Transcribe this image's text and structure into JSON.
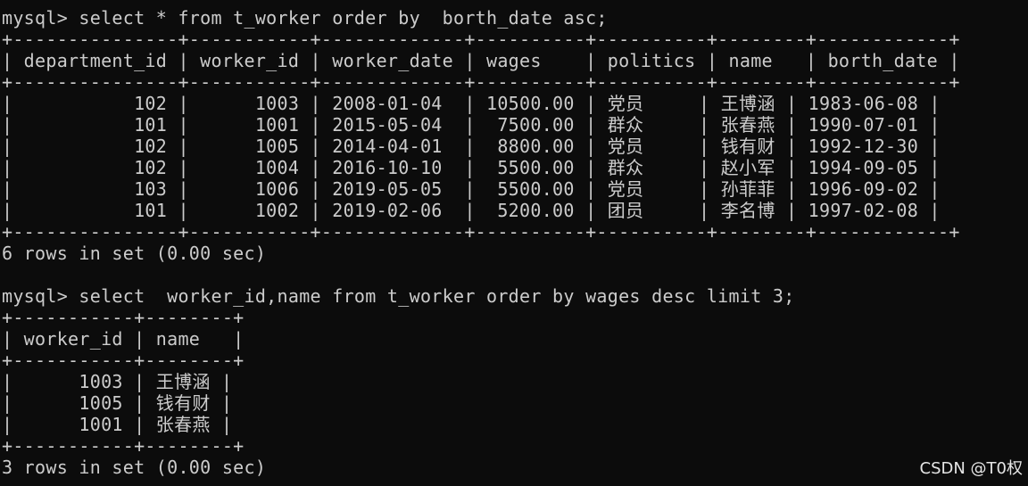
{
  "terminal": {
    "background": "#0c0c0c",
    "foreground": "#cccccc",
    "lines": [
      "mysql> select * from t_worker order by  borth_date asc;",
      "+---------------+-----------+-------------+----------+----------+--------+------------+",
      "| department_id | worker_id | worker_date | wages    | politics | name   | borth_date |",
      "+---------------+-----------+-------------+----------+----------+--------+------------+",
      "|           102 |      1003 | 2008-01-04  | 10500.00 | 党员     | 王博涵 | 1983-06-08 |",
      "|           101 |      1001 | 2015-05-04  |  7500.00 | 群众     | 张春燕 | 1990-07-01 |",
      "|           102 |      1005 | 2014-04-01  |  8800.00 | 党员     | 钱有财 | 1992-12-30 |",
      "|           102 |      1004 | 2016-10-10  |  5500.00 | 群众     | 赵小军 | 1994-09-05 |",
      "|           103 |      1006 | 2019-05-05  |  5500.00 | 党员     | 孙菲菲 | 1996-09-02 |",
      "|           101 |      1002 | 2019-02-06  |  5200.00 | 团员     | 李名博 | 1997-02-08 |",
      "+---------------+-----------+-------------+----------+----------+--------+------------+",
      "6 rows in set (0.00 sec)",
      "",
      "mysql> select  worker_id,name from t_worker order by wages desc limit 3;",
      "+-----------+--------+",
      "| worker_id | name   |",
      "+-----------+--------+",
      "|      1003 | 王博涵 |",
      "|      1005 | 钱有财 |",
      "|      1001 | 张春燕 |",
      "+-----------+--------+",
      "3 rows in set (0.00 sec)"
    ]
  },
  "watermark": "CSDN @T0权"
}
